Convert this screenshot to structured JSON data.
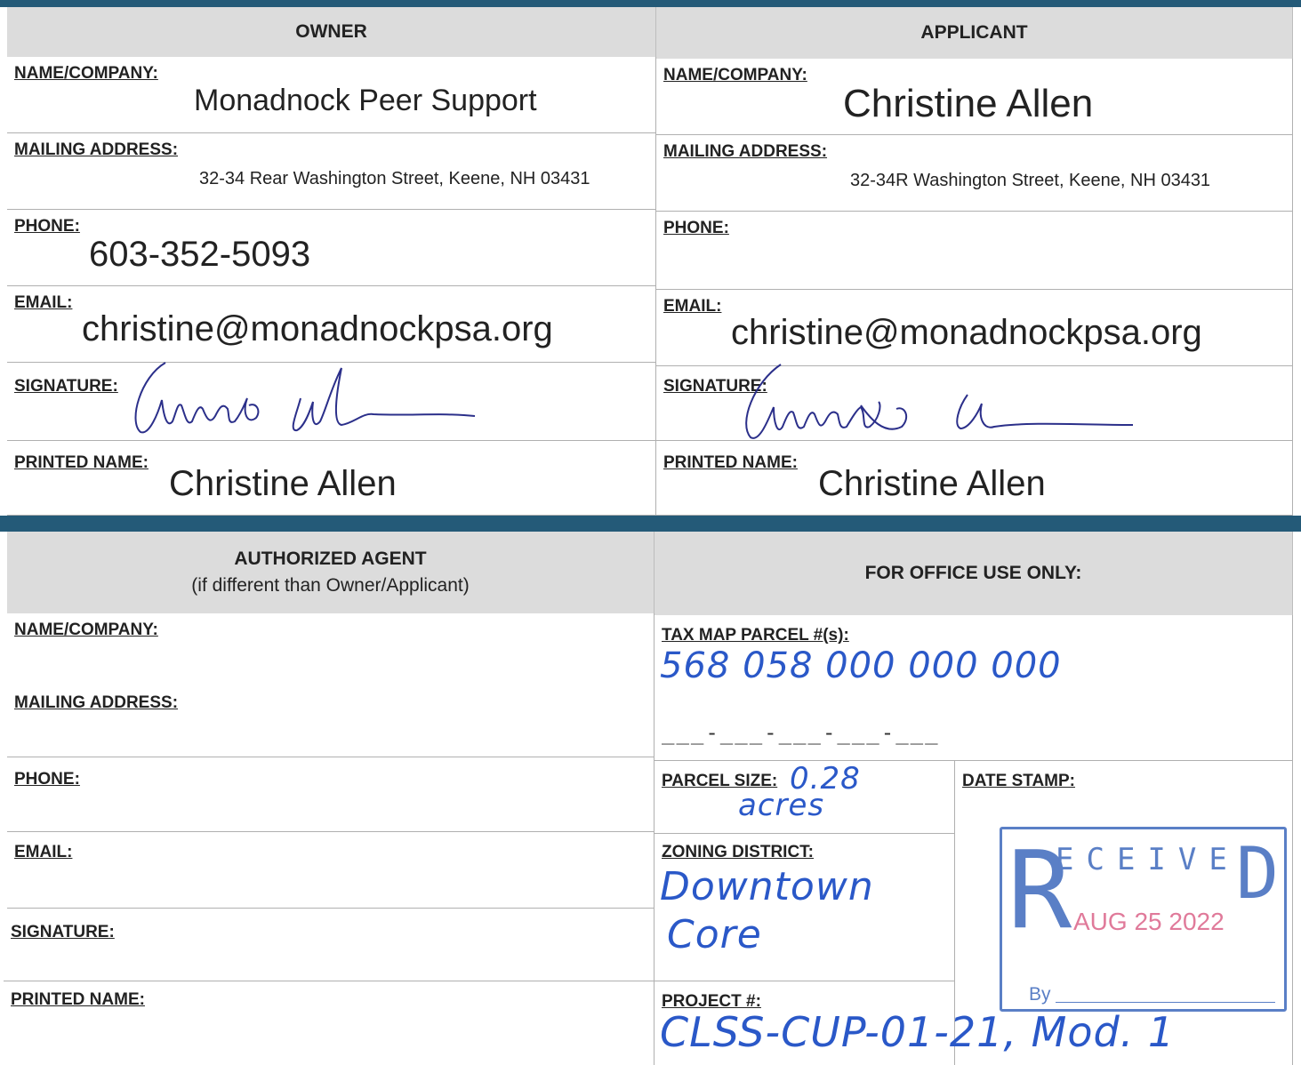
{
  "owner": {
    "header": "OWNER",
    "name_label": "NAME/COMPANY:",
    "name_value": "Monadnock Peer Support",
    "address_label": "MAILING ADDRESS:",
    "address_value": "32-34 Rear Washington Street, Keene, NH 03431",
    "phone_label": "PHONE:",
    "phone_value": "603-352-5093",
    "email_label": "EMAIL:",
    "email_value": "christine@monadnockpsa.org",
    "signature_label": "SIGNATURE:",
    "printed_label": "PRINTED NAME:",
    "printed_value": "Christine Allen"
  },
  "applicant": {
    "header": "APPLICANT",
    "name_label": "NAME/COMPANY:",
    "name_value": "Christine Allen",
    "address_label": "MAILING ADDRESS:",
    "address_value": "32-34R Washington Street, Keene, NH 03431",
    "phone_label": "PHONE:",
    "email_label": "EMAIL:",
    "email_value": "christine@monadnockpsa.org",
    "signature_label": "SIGNATURE:",
    "printed_label": "PRINTED NAME:",
    "printed_value": "Christine Allen"
  },
  "agent": {
    "header": "AUTHORIZED AGENT",
    "subheader": "(if different than Owner/Applicant)",
    "name_label": "NAME/COMPANY:",
    "address_label": "MAILING ADDRESS:",
    "phone_label": "PHONE:",
    "email_label": "EMAIL:",
    "signature_label": "SIGNATURE:",
    "printed_label": "PRINTED NAME:"
  },
  "office": {
    "header": "FOR OFFICE USE ONLY:",
    "tax_label": "TAX MAP PARCEL #(s):",
    "tax_value": "568 058 000 000 000",
    "tax_blank": "___-___-___-___-___",
    "parcel_label": "PARCEL SIZE:",
    "parcel_value_1": "0.28",
    "parcel_value_2": "acres",
    "date_label": "DATE STAMP:",
    "zoning_label": "ZONING DISTRICT:",
    "zoning_value_1": "Downtown",
    "zoning_value_2": "Core",
    "project_label": "PROJECT #:",
    "project_value": "CLSS-CUP-01-21, Mod. 1"
  },
  "stamp": {
    "received": "ECEIVE",
    "r": "R",
    "d": "D",
    "date": "AUG 25 2022",
    "by": "By"
  }
}
